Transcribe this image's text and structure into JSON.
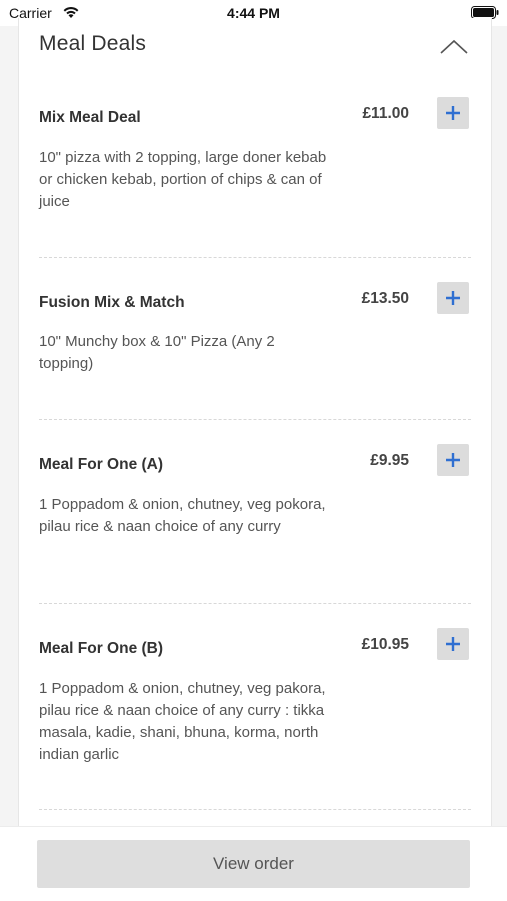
{
  "status_bar": {
    "carrier": "Carrier",
    "time": "4:44 PM"
  },
  "section": {
    "title": "Meal Deals"
  },
  "items": [
    {
      "name": "Mix Meal Deal",
      "price": "£11.00",
      "description": "10\" pizza with 2 topping, large doner kebab or chicken kebab, portion of chips & can of juice"
    },
    {
      "name": "Fusion Mix & Match",
      "price": "£13.50",
      "description": "10\" Munchy box & 10\" Pizza (Any 2 topping)"
    },
    {
      "name": "Meal For One (A)",
      "price": "£9.95",
      "description": "1 Poppadom & onion, chutney, veg pokora, pilau rice & naan choice of any curry"
    },
    {
      "name": "Meal For One (B)",
      "price": "£10.95",
      "description": "1 Poppadom & onion, chutney, veg pakora, pilau rice & naan choice of any curry : tikka masala, kadie, shani, bhuna, korma, north indian garlic"
    }
  ],
  "footer": {
    "view_order_label": "View order"
  },
  "colors": {
    "accent": "#2f6fd1",
    "button_bg": "#dcdcdc"
  },
  "icons": [
    "wifi-icon",
    "battery-icon",
    "chevron-up-icon",
    "plus-icon"
  ]
}
